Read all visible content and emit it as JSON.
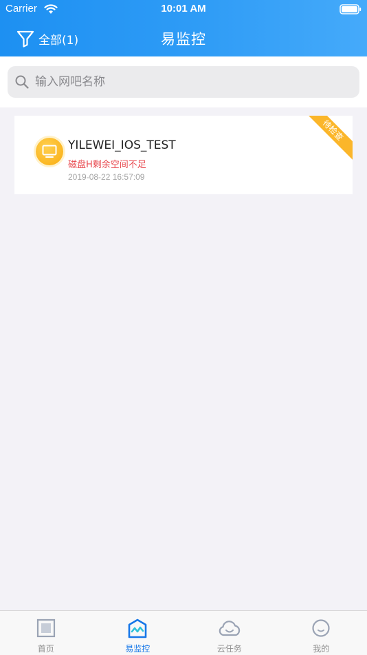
{
  "status_bar": {
    "carrier": "Carrier",
    "time": "10:01 AM"
  },
  "header": {
    "filter_label": "全部(1)",
    "title": "易监控"
  },
  "search": {
    "placeholder": "输入网吧名称"
  },
  "devices": [
    {
      "name": "YILEWEI_IOS_TEST",
      "alert": "磁盘H剩余空间不足",
      "timestamp": "2019-08-22 16:57:09",
      "badge": "待检查",
      "icon": "monitor-icon"
    }
  ],
  "tabs": [
    {
      "label": "首页",
      "icon": "home-icon",
      "active": false
    },
    {
      "label": "易监控",
      "icon": "monitor-chart-icon",
      "active": true
    },
    {
      "label": "云任务",
      "icon": "cloud-icon",
      "active": false
    },
    {
      "label": "我的",
      "icon": "profile-icon",
      "active": false
    }
  ],
  "colors": {
    "header": "#2f9cf6",
    "accent": "#1677e8",
    "alert": "#e8484e",
    "badge": "#fbb62a",
    "avatar": "#fbb722",
    "background": "#f3f2f7"
  }
}
